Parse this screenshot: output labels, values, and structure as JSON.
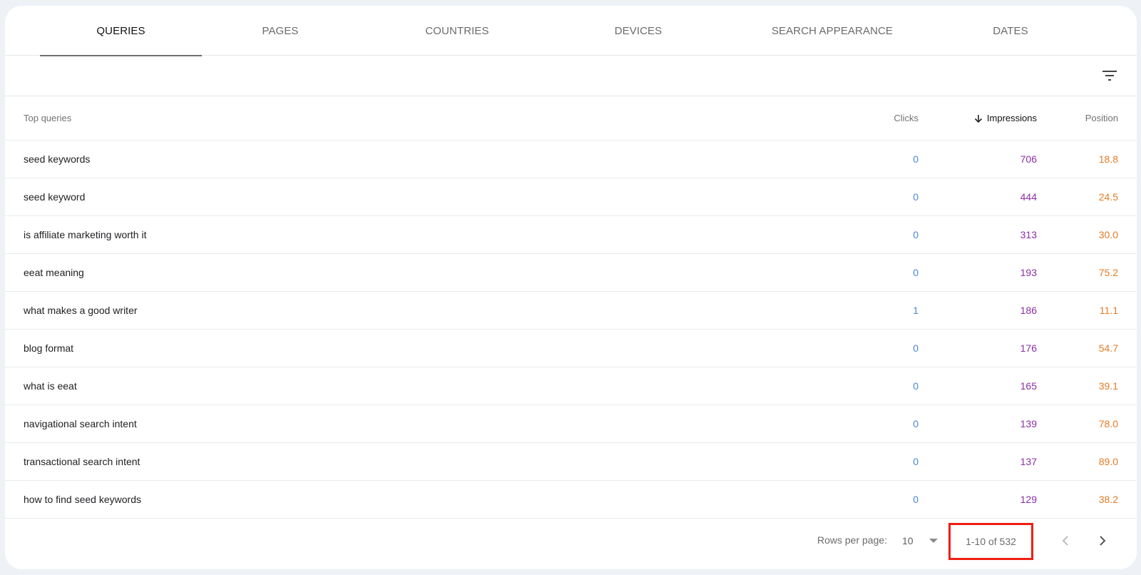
{
  "tabs": [
    {
      "label": "QUERIES",
      "active": true
    },
    {
      "label": "PAGES",
      "active": false
    },
    {
      "label": "COUNTRIES",
      "active": false
    },
    {
      "label": "DEVICES",
      "active": false
    },
    {
      "label": "SEARCH APPEARANCE",
      "active": false
    },
    {
      "label": "DATES",
      "active": false
    }
  ],
  "toolbar": {
    "filter_icon": "filter-list-icon"
  },
  "table": {
    "headers": {
      "query": "Top queries",
      "clicks": "Clicks",
      "impressions": "Impressions",
      "position": "Position",
      "sorted_by": "impressions",
      "sort_direction": "descending"
    },
    "rows": [
      {
        "query": "seed keywords",
        "clicks": "0",
        "impressions": "706",
        "position": "18.8"
      },
      {
        "query": "seed keyword",
        "clicks": "0",
        "impressions": "444",
        "position": "24.5"
      },
      {
        "query": "is affiliate marketing worth it",
        "clicks": "0",
        "impressions": "313",
        "position": "30.0"
      },
      {
        "query": "eeat meaning",
        "clicks": "0",
        "impressions": "193",
        "position": "75.2"
      },
      {
        "query": "what makes a good writer",
        "clicks": "1",
        "impressions": "186",
        "position": "11.1"
      },
      {
        "query": "blog format",
        "clicks": "0",
        "impressions": "176",
        "position": "54.7"
      },
      {
        "query": "what is eeat",
        "clicks": "0",
        "impressions": "165",
        "position": "39.1"
      },
      {
        "query": "navigational search intent",
        "clicks": "0",
        "impressions": "139",
        "position": "78.0"
      },
      {
        "query": "transactional search intent",
        "clicks": "0",
        "impressions": "137",
        "position": "89.0"
      },
      {
        "query": "how to find seed keywords",
        "clicks": "0",
        "impressions": "129",
        "position": "38.2"
      }
    ]
  },
  "footer": {
    "rows_per_page_label": "Rows per page:",
    "rows_per_page_value": "10",
    "range_text": "1-10 of 532",
    "prev_icon": "chevron-left-icon",
    "next_icon": "chevron-right-icon"
  },
  "colors": {
    "clicks": "#4a86d8",
    "impressions": "#8d2ea8",
    "position": "#e37b25",
    "highlight_box": "#ee1f10"
  }
}
